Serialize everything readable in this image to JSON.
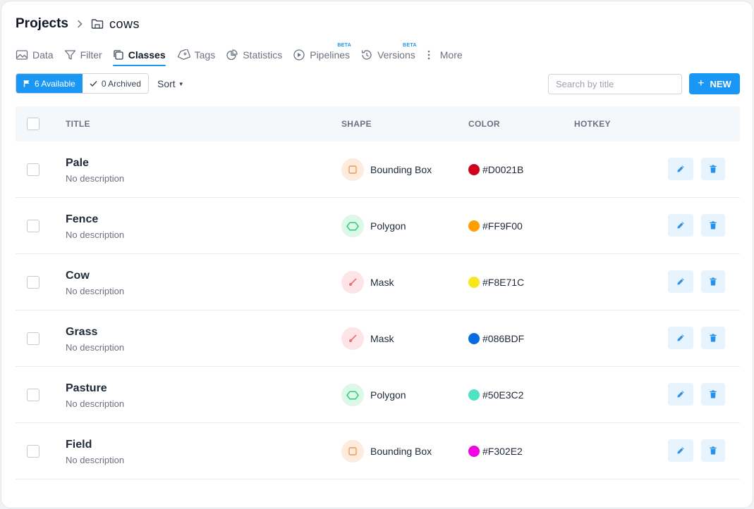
{
  "breadcrumb": {
    "root": "Projects",
    "current": "cows"
  },
  "tabs": [
    {
      "label": "Data",
      "icon": "image-icon",
      "active": false,
      "badge": ""
    },
    {
      "label": "Filter",
      "icon": "filter-icon",
      "active": false,
      "badge": ""
    },
    {
      "label": "Classes",
      "icon": "copy-icon",
      "active": true,
      "badge": ""
    },
    {
      "label": "Tags",
      "icon": "tag-icon",
      "active": false,
      "badge": ""
    },
    {
      "label": "Statistics",
      "icon": "pie-chart-icon",
      "active": false,
      "badge": ""
    },
    {
      "label": "Pipelines",
      "icon": "play-circle-icon",
      "active": false,
      "badge": "BETA"
    },
    {
      "label": "Versions",
      "icon": "history-icon",
      "active": false,
      "badge": "BETA"
    },
    {
      "label": "More",
      "icon": "more-vertical-icon",
      "active": false,
      "badge": ""
    }
  ],
  "toolbar": {
    "available_label": "6 Available",
    "archived_label": "0 Archived",
    "sort_label": "Sort",
    "search_placeholder": "Search by title",
    "new_label": "NEW"
  },
  "table": {
    "columns": {
      "title": "TITLE",
      "shape": "SHAPE",
      "color": "COLOR",
      "hotkey": "HOTKEY"
    },
    "rows": [
      {
        "title": "Pale",
        "description": "No description",
        "shape": "Bounding Box",
        "shape_icon": "bounding-box-icon",
        "color": "#D0021B",
        "hotkey": ""
      },
      {
        "title": "Fence",
        "description": "No description",
        "shape": "Polygon",
        "shape_icon": "polygon-icon",
        "color": "#FF9F00",
        "hotkey": ""
      },
      {
        "title": "Cow",
        "description": "No description",
        "shape": "Mask",
        "shape_icon": "brush-icon",
        "color": "#F8E71C",
        "hotkey": ""
      },
      {
        "title": "Grass",
        "description": "No description",
        "shape": "Mask",
        "shape_icon": "brush-icon",
        "color": "#086BDF",
        "hotkey": ""
      },
      {
        "title": "Pasture",
        "description": "No description",
        "shape": "Polygon",
        "shape_icon": "polygon-icon",
        "color": "#50E3C2",
        "hotkey": ""
      },
      {
        "title": "Field",
        "description": "No description",
        "shape": "Bounding Box",
        "shape_icon": "bounding-box-icon",
        "color": "#F302E2",
        "hotkey": ""
      }
    ]
  },
  "theme": {
    "accent": "#1a97f5"
  }
}
